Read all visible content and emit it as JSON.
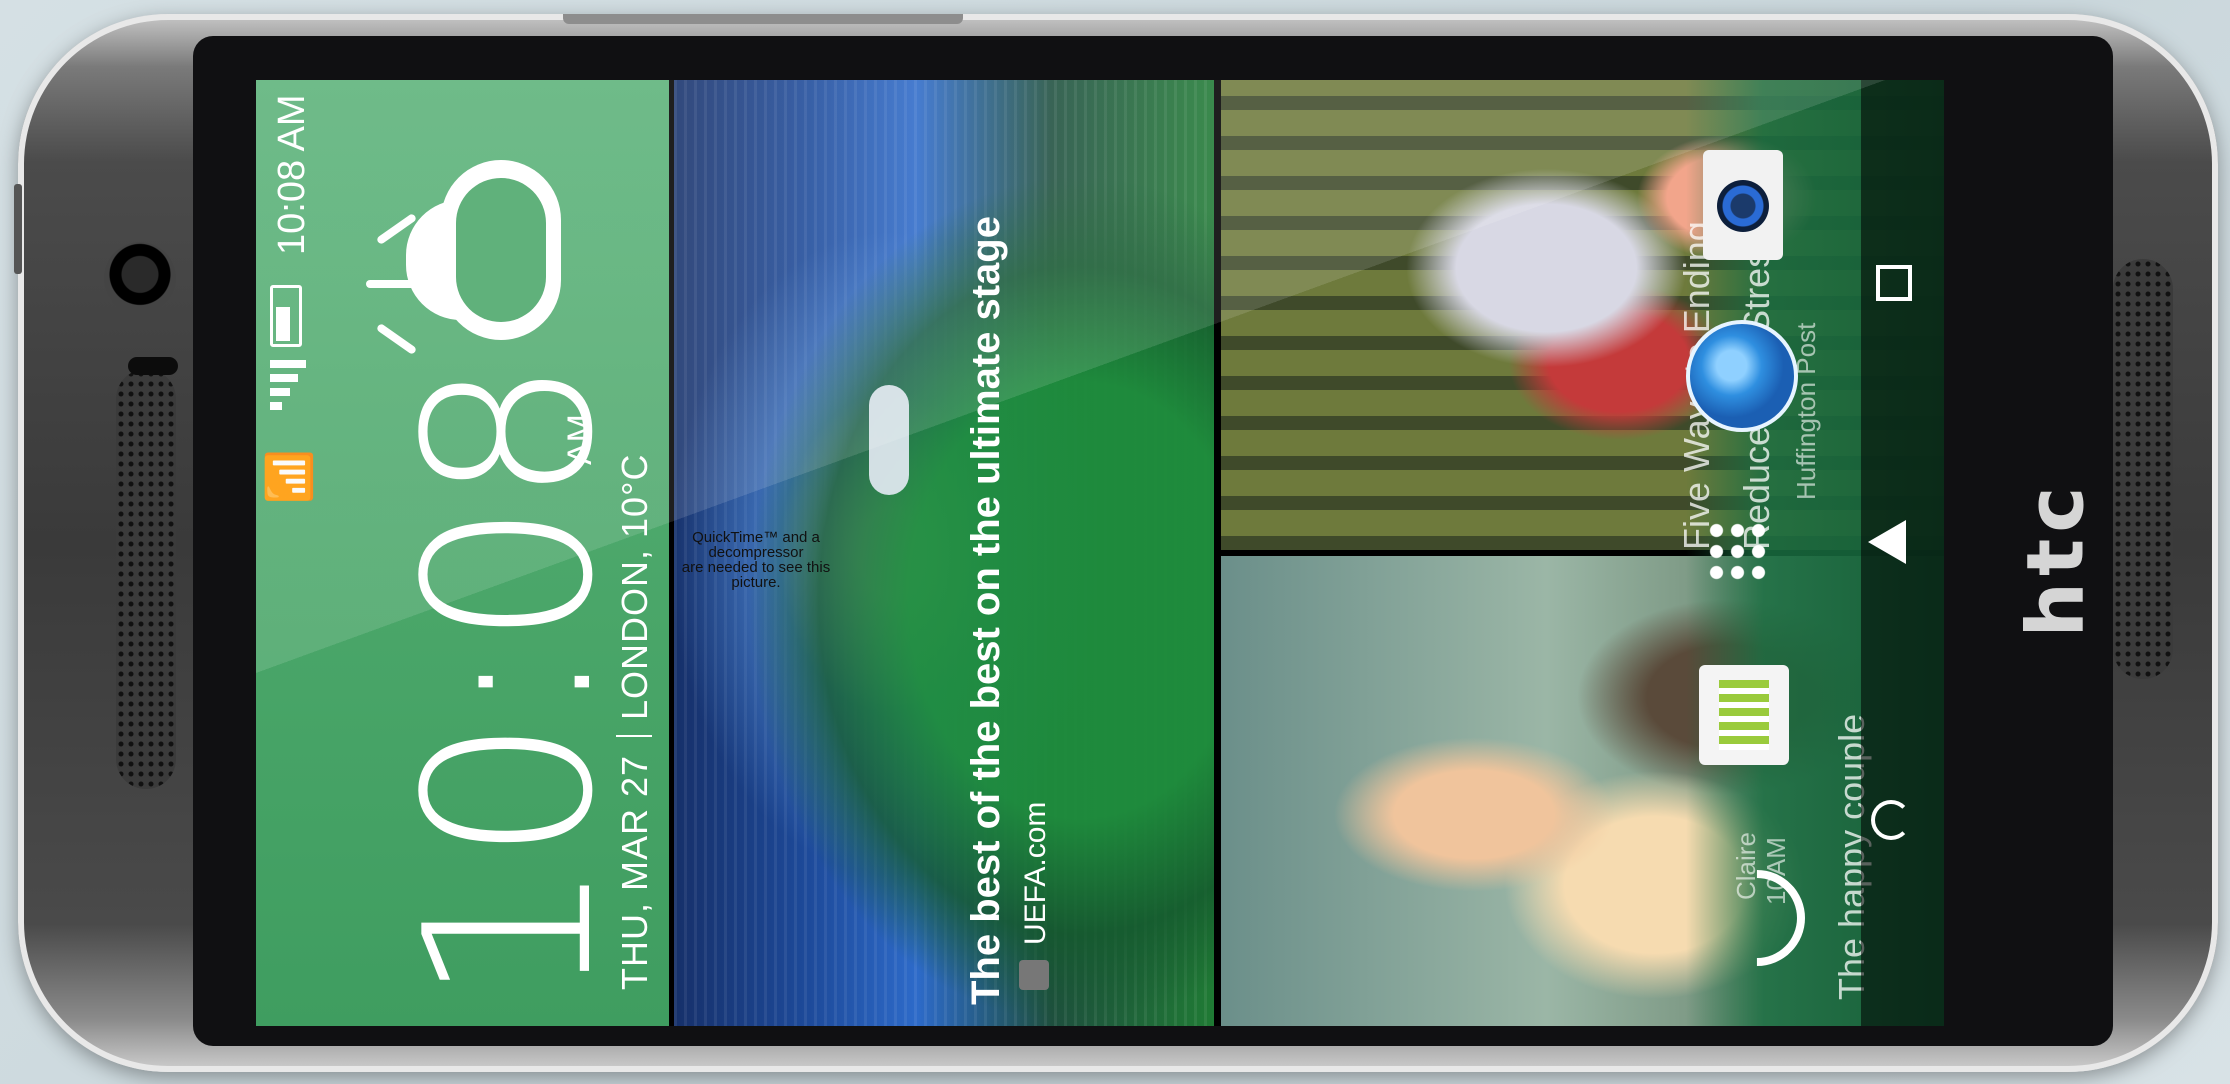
{
  "device": {
    "brand": "htc"
  },
  "status_bar": {
    "time": "10:08 AM"
  },
  "clock_widget": {
    "time": "10:08",
    "ampm": "AM",
    "date": "THU, MAR 27",
    "location_temp": "LONDON, 10°C"
  },
  "feed": {
    "headline": "The best of the best on the ultimate stage",
    "source": "UEFA.com",
    "placeholder_line1": "QuickTime™ and a",
    "placeholder_line2": "decompressor",
    "placeholder_line3": "are needed to see this picture.",
    "article2_title_a": "Five Ways to Ending",
    "article2_title_b": "Reduce Your Stress",
    "article2_source": "Huffington Post",
    "photo_caption": "The happy couple",
    "notif_name": "Claire",
    "notif_time": "10AM"
  },
  "colors": {
    "widget_green": "#4aa669"
  }
}
